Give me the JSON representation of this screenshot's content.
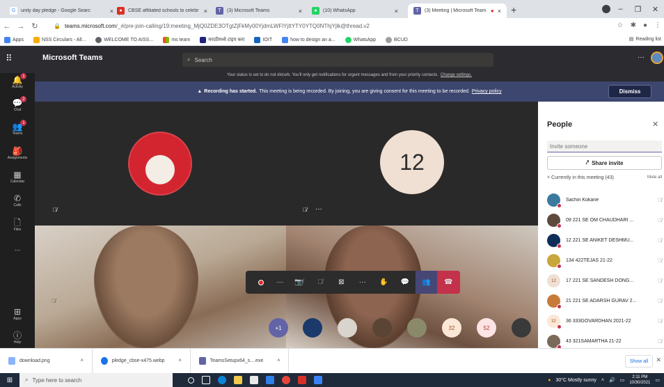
{
  "browser": {
    "tabs": [
      {
        "label": "unity day pledge - Google Searc",
        "icon": "google-icon",
        "color": "#4285f4"
      },
      {
        "label": "CBSE affiliated schools to celebr",
        "icon": "cbse-icon",
        "color": "#d93025"
      },
      {
        "label": "(3) Microsoft Teams",
        "icon": "teams-icon",
        "color": "#6264a7"
      },
      {
        "label": "(10) WhatsApp",
        "icon": "whatsapp-icon",
        "color": "#25d366"
      },
      {
        "label": "(3) Meeting | Microsoft Team",
        "icon": "teams-icon",
        "color": "#6264a7"
      }
    ],
    "url_host": "teams.microsoft.com",
    "url_path": "/_#/pre-join-calling/19:meeting_MjQ0ZDE3OTgtZjFkMy00YjdmLWFlYjItYTY0YTQ0NThjYjlk@thread.v2",
    "bookmarks": [
      "Apps",
      "NSS Circulars - All...",
      "WELCOME TO AISS...",
      "ms team",
      "मराठीमध्ये टाइप करा",
      "IOIT",
      "how to design an a...",
      "WhatsApp",
      "BCUD"
    ],
    "reading_list": "Reading list"
  },
  "teams": {
    "app_name": "Microsoft Teams",
    "search_placeholder": "Search",
    "rail": [
      {
        "label": "Activity",
        "badge": "1"
      },
      {
        "label": "Chat",
        "badge": "2"
      },
      {
        "label": "Teams",
        "badge": "1"
      },
      {
        "label": "Assignments",
        "badge": ""
      },
      {
        "label": "Calendar",
        "badge": ""
      },
      {
        "label": "Calls",
        "badge": ""
      },
      {
        "label": "Files",
        "badge": ""
      },
      {
        "label": "...",
        "badge": ""
      },
      {
        "label": "Apps",
        "badge": ""
      },
      {
        "label": "Help",
        "badge": ""
      }
    ],
    "notice": {
      "text": "Your status is set to do not disturb. You'll only get notifications for urgent messages and from your priority contacts.",
      "link": "Change settings."
    },
    "recording": {
      "bold": "Recording has started.",
      "text": "This meeting is being recorded. By joining, you are giving consent for this meeting to be recorded.",
      "link": "Privacy policy",
      "dismiss": "Dismiss"
    },
    "tile2_avatar": "12",
    "strip": [
      {
        "label": "+1",
        "bg": "#6264a7",
        "fg": "#ffffff"
      },
      {
        "label": "",
        "bg": "#1b3a6b",
        "fg": "#ffffff"
      },
      {
        "label": "",
        "bg": "#d9d4cc",
        "fg": "#000000"
      },
      {
        "label": "",
        "bg": "#5a4535",
        "fg": "#ffffff"
      },
      {
        "label": "",
        "bg": "#8a8a6a",
        "fg": "#ffffff"
      },
      {
        "label": "32",
        "bg": "#fbe7d5",
        "fg": "#a0522d"
      },
      {
        "label": "52",
        "bg": "#fde4e4",
        "fg": "#a33"
      },
      {
        "label": "",
        "bg": "#3a3a3a",
        "fg": "#ffffff"
      }
    ],
    "people": {
      "title": "People",
      "invite_placeholder": "Invite someone",
      "share_invite": "Share invite",
      "current": "Currently in this meeting (43)",
      "mute_all": "Mute all",
      "list": [
        {
          "name": "Sachin Kokane",
          "avatar": "",
          "bg": "#3b7a9e",
          "dnd": true
        },
        {
          "name": "09 221 SE OM CHAUDHARI ...",
          "avatar": "",
          "bg": "#5e4a3d",
          "dnd": true
        },
        {
          "name": "12 221 SE ANIKET DESHMU...",
          "avatar": "",
          "bg": "#0f2f5a",
          "dnd": true
        },
        {
          "name": "134 422TEJAS 21-22",
          "avatar": "",
          "bg": "#c9a63a",
          "dnd": true
        },
        {
          "name": "17 221 SE SANDESH DONG...",
          "avatar": "12",
          "bg": "#efe0d3",
          "dnd": false
        },
        {
          "name": "21 221 SE ADARSH GURAV 2...",
          "avatar": "",
          "bg": "#c77b3a",
          "dnd": true
        },
        {
          "name": "36 333GOVARDHAN 2021-22",
          "avatar": "32",
          "bg": "#fbe7d5",
          "dnd": true
        },
        {
          "name": "43 321SAMARTHA 21-22",
          "avatar": "",
          "bg": "#7a6a5a",
          "dnd": true
        }
      ]
    }
  },
  "downloads": [
    {
      "name": "download.png",
      "color": "#8ab4f8"
    },
    {
      "name": "pledge_cbse-x475.webp",
      "color": "#1a73e8"
    },
    {
      "name": "TeamsSetupx64_s....exe",
      "color": "#6264a7"
    }
  ],
  "show_all": "Show all",
  "taskbar": {
    "search_placeholder": "Type here to search",
    "weather": "30°C  Mostly sunny",
    "time": "2:11 PM",
    "date": "10/30/2021"
  }
}
